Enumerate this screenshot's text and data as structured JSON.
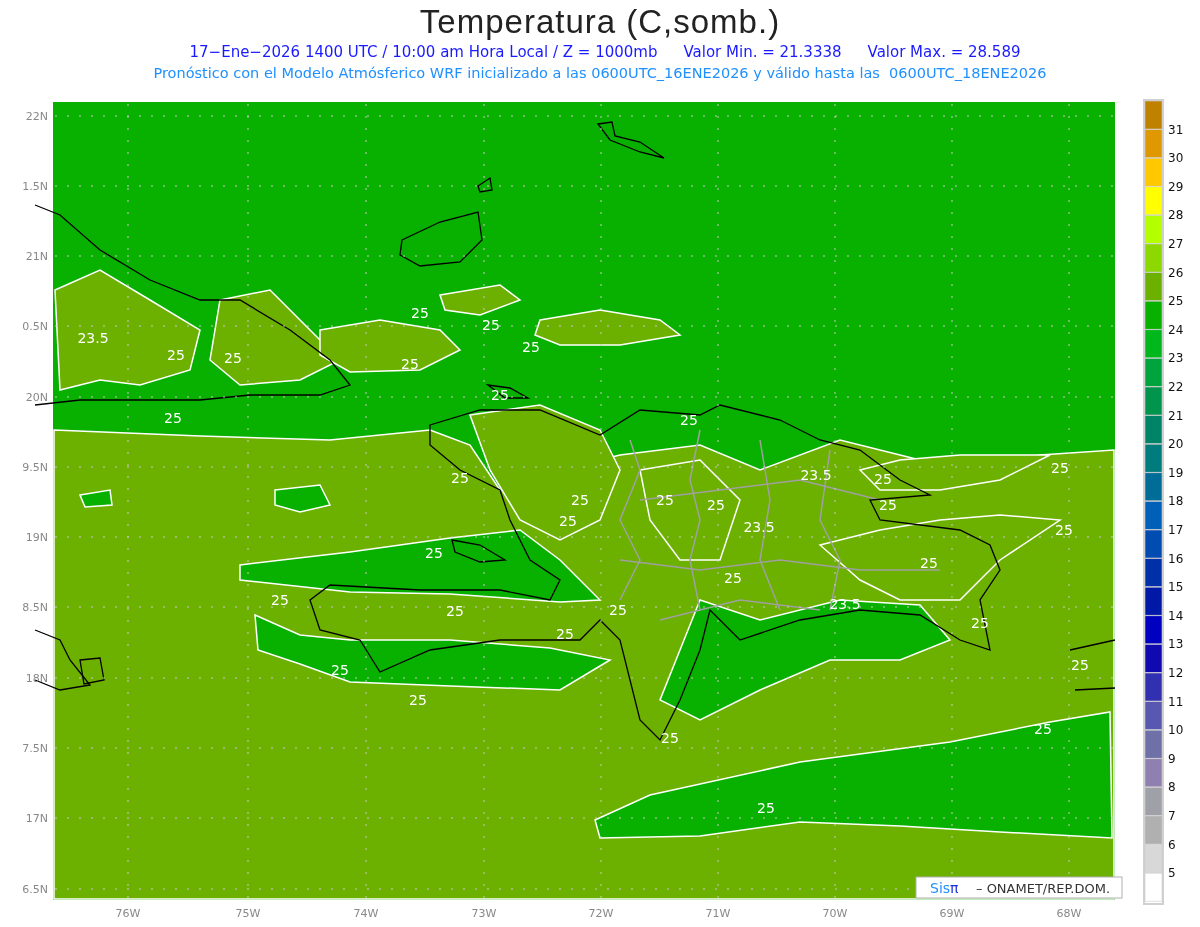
{
  "header": {
    "title": "Temperatura (C,somb.)",
    "valid_time": "17−Ene−2026 1400 UTC / 10:00 am Hora Local / Z = 1000mb",
    "min_value": "Valor Min. = 21.3338",
    "max_value": "Valor Max. = 28.589",
    "forecast": "Pronóstico con el Modelo Atmósferico WRF inicializado a las 0600UTC_16ENE2026 y válido hasta las  0600UTC_18ENE2026"
  },
  "map": {
    "lat_labels": [
      "22N",
      "1.5N",
      "21N",
      "0.5N",
      "20N",
      "9.5N",
      "19N",
      "8.5N",
      "18N",
      "7.5N",
      "17N",
      "6.5N"
    ],
    "lon_labels": [
      "76W",
      "75W",
      "74W",
      "73W",
      "72W",
      "71W",
      "70W",
      "69W",
      "68W"
    ],
    "contour_labels": [
      "25",
      "25",
      "23.5",
      "25",
      "25",
      "25",
      "25",
      "25",
      "25",
      "25",
      "25",
      "23.5",
      "25",
      "25",
      "25",
      "25",
      "25",
      "25",
      "25",
      "23.5",
      "25",
      "25",
      "25",
      "25",
      "25",
      "25",
      "25",
      "23.5",
      "25",
      "25",
      "25",
      "25",
      "25",
      "25",
      "25",
      "25"
    ]
  },
  "colorbar": {
    "segments": [
      {
        "color": "#c08000",
        "label": "31"
      },
      {
        "color": "#e09800",
        "label": "30"
      },
      {
        "color": "#ffc800",
        "label": "29"
      },
      {
        "color": "#ffff00",
        "label": "28"
      },
      {
        "color": "#b4ff00",
        "label": "27"
      },
      {
        "color": "#8cd800",
        "label": "26"
      },
      {
        "color": "#6cb000",
        "label": "25"
      },
      {
        "color": "#08b000",
        "label": "24"
      },
      {
        "color": "#00b81c",
        "label": "23"
      },
      {
        "color": "#00a43c",
        "label": "22"
      },
      {
        "color": "#00944c",
        "label": "21"
      },
      {
        "color": "#008468",
        "label": "20"
      },
      {
        "color": "#007c7c",
        "label": "19"
      },
      {
        "color": "#006c98",
        "label": "18"
      },
      {
        "color": "#0060b8",
        "label": "17"
      },
      {
        "color": "#004cb0",
        "label": "16"
      },
      {
        "color": "#0030a8",
        "label": "15"
      },
      {
        "color": "#0018a8",
        "label": "14"
      },
      {
        "color": "#0000c0",
        "label": "13"
      },
      {
        "color": "#1008b0",
        "label": "12"
      },
      {
        "color": "#3030b0",
        "label": "11"
      },
      {
        "color": "#5858b0",
        "label": "10"
      },
      {
        "color": "#7070a8",
        "label": "9"
      },
      {
        "color": "#9080b0",
        "label": "8"
      },
      {
        "color": "#a0a0a8",
        "label": "7"
      },
      {
        "color": "#b0b0b0",
        "label": "6"
      },
      {
        "color": "#d8d8d8",
        "label": "5"
      },
      {
        "color": "#ffffff"
      }
    ]
  },
  "credit": {
    "logo_prefix": "Sis",
    "logo_symbol": "π",
    "text": "– ONAMET/REP.DOM."
  }
}
